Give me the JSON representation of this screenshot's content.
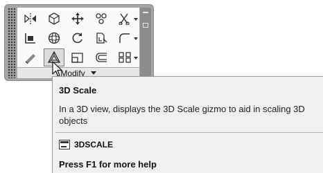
{
  "panel": {
    "title": "Modify",
    "tools": [
      {
        "row": 1,
        "col": 1,
        "icon": "mirror-icon",
        "dropdown": false
      },
      {
        "row": 1,
        "col": 2,
        "icon": "3d-move-gizmo-icon",
        "dropdown": false
      },
      {
        "row": 1,
        "col": 3,
        "icon": "move-icon",
        "dropdown": false
      },
      {
        "row": 1,
        "col": 4,
        "icon": "copy-icon",
        "dropdown": false
      },
      {
        "row": 1,
        "col": 5,
        "icon": "trim-icon",
        "dropdown": true
      },
      {
        "row": 2,
        "col": 1,
        "icon": "align-icon",
        "dropdown": false
      },
      {
        "row": 2,
        "col": 2,
        "icon": "3d-rotate-gizmo-icon",
        "dropdown": false
      },
      {
        "row": 2,
        "col": 3,
        "icon": "rotate-icon",
        "dropdown": false
      },
      {
        "row": 2,
        "col": 4,
        "icon": "copy-clip-icon",
        "dropdown": false
      },
      {
        "row": 2,
        "col": 5,
        "icon": "fillet-icon",
        "dropdown": true
      },
      {
        "row": 3,
        "col": 1,
        "icon": "erase-icon",
        "dropdown": false
      },
      {
        "row": 3,
        "col": 2,
        "icon": "3d-scale-icon",
        "dropdown": false,
        "active": true
      },
      {
        "row": 3,
        "col": 3,
        "icon": "stretch-icon",
        "dropdown": false
      },
      {
        "row": 3,
        "col": 4,
        "icon": "offset-icon",
        "dropdown": false
      },
      {
        "row": 3,
        "col": 5,
        "icon": "array-icon",
        "dropdown": true
      }
    ]
  },
  "tooltip": {
    "title": "3D Scale",
    "description": "In a 3D view, displays the 3D Scale gizmo to aid in scaling 3D objects",
    "command": "3DSCALE",
    "command_icon": "command-window-icon",
    "help": "Press F1 for more help"
  },
  "colors": {
    "panel_frame": "#a6a6a6",
    "tool_area": "#fafafa",
    "tooltip_bg": "#f0f0f0"
  }
}
